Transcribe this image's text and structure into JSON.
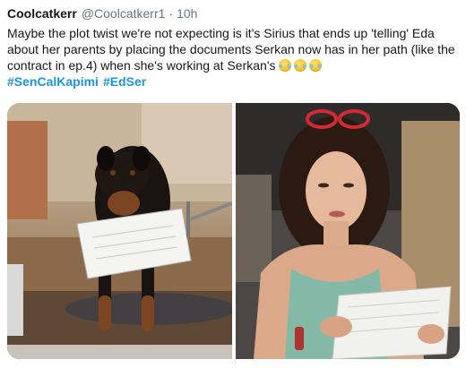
{
  "tweet": {
    "display_name": "Coolcatkerr",
    "handle": "@Coolcatkerr1",
    "separator": "·",
    "time": "10h",
    "text": "Maybe the plot twist we're not expecting is it's Sirius that ends up 'telling' Eda about her parents by placing the documents Serkan now has in her path (like the contract in ep.4) when she's working at Serkan's",
    "emoji": [
      "tears-of-joy-emoji",
      "tears-of-joy-emoji",
      "tears-of-joy-emoji"
    ],
    "hashtags": [
      "#SenCalKapimi",
      "#EdSer"
    ]
  },
  "colors": {
    "link": "#1b95e0",
    "text": "#14171a",
    "muted": "#657786"
  }
}
